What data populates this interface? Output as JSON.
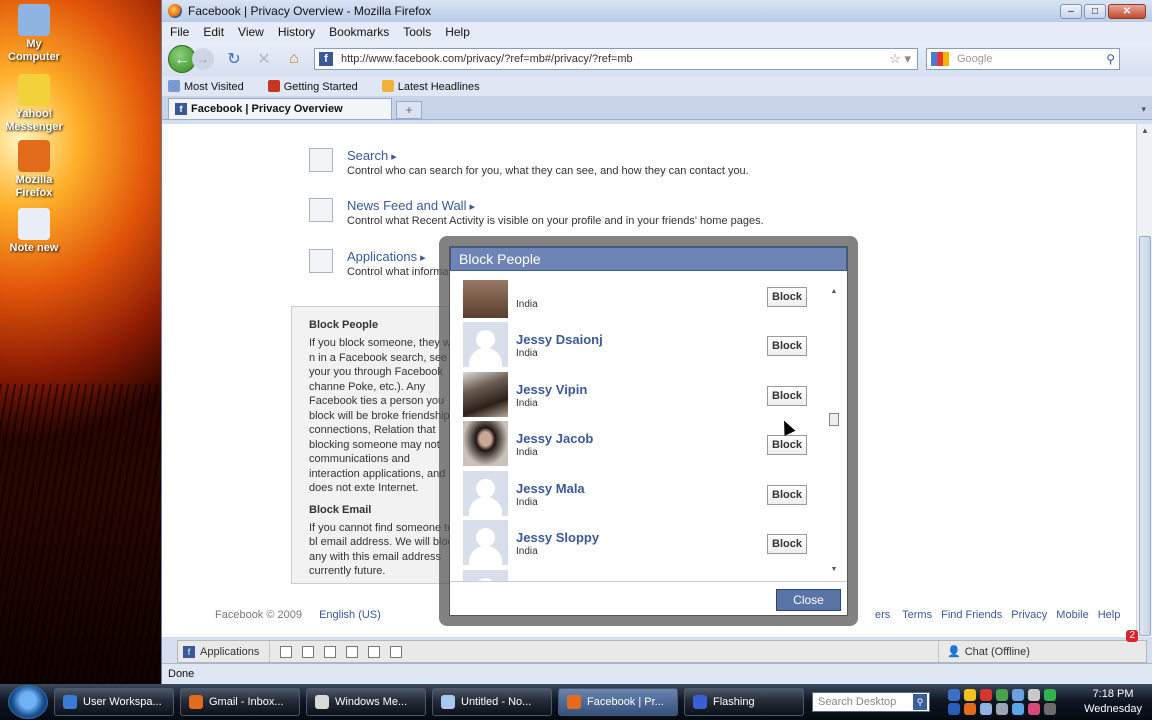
{
  "desktop": {
    "icons": [
      {
        "label": "My Computer",
        "color": "#8fb4e2"
      },
      {
        "label": "Yahoo! Messenger",
        "color": "#f2d23a"
      },
      {
        "label": "Mozilla Firefox",
        "color": "#e26b1c"
      },
      {
        "label": "Note new",
        "color": "#e9eef6"
      }
    ]
  },
  "window": {
    "title": "Facebook | Privacy Overview - Mozilla Firefox",
    "menu": [
      "File",
      "Edit",
      "View",
      "History",
      "Bookmarks",
      "Tools",
      "Help"
    ],
    "url": "http://www.facebook.com/privacy/?ref=mb#/privacy/?ref=mb",
    "search_placeholder": "Google",
    "bookmarks": [
      "Most Visited",
      "Getting Started",
      "Latest Headlines"
    ],
    "tab_title": "Facebook | Privacy Overview",
    "status": "Done"
  },
  "privacy": {
    "items": [
      {
        "title": "Search",
        "desc": "Control who can search for you, what they can see, and how they can contact you."
      },
      {
        "title": "News Feed and Wall",
        "desc": "Control what Recent Activity is visible on your profile and in your friends' home pages."
      },
      {
        "title": "Applications",
        "desc": "Control what informati"
      }
    ],
    "block_people_heading": "Block People",
    "block_people_text": "If you block someone, they will n in a Facebook search, see your you through Facebook channe Poke, etc.). Any Facebook ties a person you block will be broke friendship connections, Relation that blocking someone may not communications and interaction applications, and does not exte Internet.",
    "block_email_heading": "Block Email",
    "block_email_text": "If you cannot find someone to bl email address. We will block any with this email address currently future."
  },
  "footer": {
    "copyright": "Facebook © 2009",
    "language": "English (US)",
    "links": [
      "Terms",
      "Find Friends",
      "Privacy",
      "Mobile",
      "Help"
    ],
    "links_partial": "ers"
  },
  "fbbar": {
    "applications": "Applications",
    "chat": "Chat (Offline)",
    "notifications": "2"
  },
  "modal": {
    "title": "Block People",
    "people": [
      {
        "name": "",
        "location": "India",
        "button": "Block",
        "pic": "photo0"
      },
      {
        "name": "Jessy Dsaionj",
        "location": "India",
        "button": "Block",
        "pic": "blank"
      },
      {
        "name": "Jessy Vipin",
        "location": "India",
        "button": "Block",
        "pic": "photo1"
      },
      {
        "name": "Jessy Jacob",
        "location": "India",
        "button": "Block",
        "pic": "photo2"
      },
      {
        "name": "Jessy Mala",
        "location": "India",
        "button": "Block",
        "pic": "blank"
      },
      {
        "name": "Jessy Sloppy",
        "location": "India",
        "button": "Block",
        "pic": "blank"
      },
      {
        "name": "",
        "location": "",
        "button": "",
        "pic": "blank"
      }
    ],
    "close_label": "Close"
  },
  "taskbar": {
    "tasks": [
      {
        "label": "User Workspa...",
        "color": "#3a7bd5",
        "active": false
      },
      {
        "label": "Gmail - Inbox...",
        "color": "#e26b1c",
        "active": false
      },
      {
        "label": "Windows Me...",
        "color": "#d9d9d9",
        "active": false
      },
      {
        "label": "Untitled - No...",
        "color": "#a9c8ef",
        "active": false
      },
      {
        "label": "Facebook | Pr...",
        "color": "#e26b1c",
        "active": true
      },
      {
        "label": "Flashing",
        "color": "#3a5fd5",
        "active": false
      }
    ],
    "search_placeholder": "Search Desktop",
    "time": "7:18 PM",
    "day": "Wednesday"
  }
}
